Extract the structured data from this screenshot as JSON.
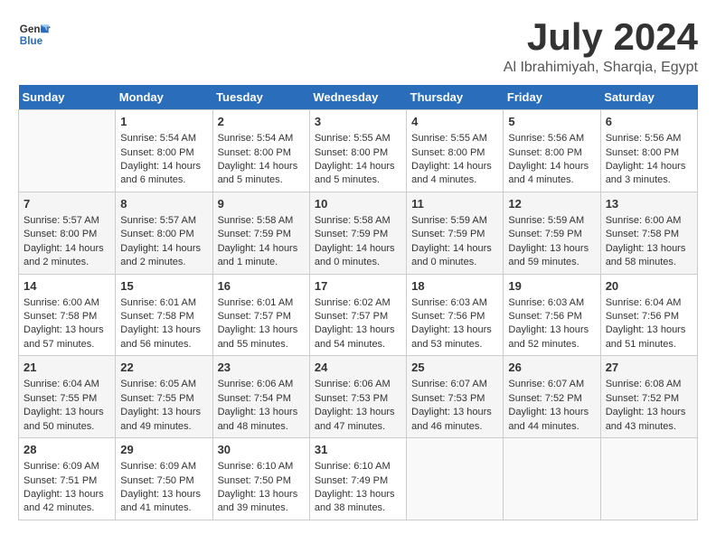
{
  "header": {
    "logo_line1": "General",
    "logo_line2": "Blue",
    "month_year": "July 2024",
    "location": "Al Ibrahimiyah, Sharqia, Egypt"
  },
  "days_of_week": [
    "Sunday",
    "Monday",
    "Tuesday",
    "Wednesday",
    "Thursday",
    "Friday",
    "Saturday"
  ],
  "weeks": [
    [
      {
        "day": "",
        "content": ""
      },
      {
        "day": "1",
        "content": "Sunrise: 5:54 AM\nSunset: 8:00 PM\nDaylight: 14 hours\nand 6 minutes."
      },
      {
        "day": "2",
        "content": "Sunrise: 5:54 AM\nSunset: 8:00 PM\nDaylight: 14 hours\nand 5 minutes."
      },
      {
        "day": "3",
        "content": "Sunrise: 5:55 AM\nSunset: 8:00 PM\nDaylight: 14 hours\nand 5 minutes."
      },
      {
        "day": "4",
        "content": "Sunrise: 5:55 AM\nSunset: 8:00 PM\nDaylight: 14 hours\nand 4 minutes."
      },
      {
        "day": "5",
        "content": "Sunrise: 5:56 AM\nSunset: 8:00 PM\nDaylight: 14 hours\nand 4 minutes."
      },
      {
        "day": "6",
        "content": "Sunrise: 5:56 AM\nSunset: 8:00 PM\nDaylight: 14 hours\nand 3 minutes."
      }
    ],
    [
      {
        "day": "7",
        "content": "Sunrise: 5:57 AM\nSunset: 8:00 PM\nDaylight: 14 hours\nand 2 minutes."
      },
      {
        "day": "8",
        "content": "Sunrise: 5:57 AM\nSunset: 8:00 PM\nDaylight: 14 hours\nand 2 minutes."
      },
      {
        "day": "9",
        "content": "Sunrise: 5:58 AM\nSunset: 7:59 PM\nDaylight: 14 hours\nand 1 minute."
      },
      {
        "day": "10",
        "content": "Sunrise: 5:58 AM\nSunset: 7:59 PM\nDaylight: 14 hours\nand 0 minutes."
      },
      {
        "day": "11",
        "content": "Sunrise: 5:59 AM\nSunset: 7:59 PM\nDaylight: 14 hours\nand 0 minutes."
      },
      {
        "day": "12",
        "content": "Sunrise: 5:59 AM\nSunset: 7:59 PM\nDaylight: 13 hours\nand 59 minutes."
      },
      {
        "day": "13",
        "content": "Sunrise: 6:00 AM\nSunset: 7:58 PM\nDaylight: 13 hours\nand 58 minutes."
      }
    ],
    [
      {
        "day": "14",
        "content": "Sunrise: 6:00 AM\nSunset: 7:58 PM\nDaylight: 13 hours\nand 57 minutes."
      },
      {
        "day": "15",
        "content": "Sunrise: 6:01 AM\nSunset: 7:58 PM\nDaylight: 13 hours\nand 56 minutes."
      },
      {
        "day": "16",
        "content": "Sunrise: 6:01 AM\nSunset: 7:57 PM\nDaylight: 13 hours\nand 55 minutes."
      },
      {
        "day": "17",
        "content": "Sunrise: 6:02 AM\nSunset: 7:57 PM\nDaylight: 13 hours\nand 54 minutes."
      },
      {
        "day": "18",
        "content": "Sunrise: 6:03 AM\nSunset: 7:56 PM\nDaylight: 13 hours\nand 53 minutes."
      },
      {
        "day": "19",
        "content": "Sunrise: 6:03 AM\nSunset: 7:56 PM\nDaylight: 13 hours\nand 52 minutes."
      },
      {
        "day": "20",
        "content": "Sunrise: 6:04 AM\nSunset: 7:56 PM\nDaylight: 13 hours\nand 51 minutes."
      }
    ],
    [
      {
        "day": "21",
        "content": "Sunrise: 6:04 AM\nSunset: 7:55 PM\nDaylight: 13 hours\nand 50 minutes."
      },
      {
        "day": "22",
        "content": "Sunrise: 6:05 AM\nSunset: 7:55 PM\nDaylight: 13 hours\nand 49 minutes."
      },
      {
        "day": "23",
        "content": "Sunrise: 6:06 AM\nSunset: 7:54 PM\nDaylight: 13 hours\nand 48 minutes."
      },
      {
        "day": "24",
        "content": "Sunrise: 6:06 AM\nSunset: 7:53 PM\nDaylight: 13 hours\nand 47 minutes."
      },
      {
        "day": "25",
        "content": "Sunrise: 6:07 AM\nSunset: 7:53 PM\nDaylight: 13 hours\nand 46 minutes."
      },
      {
        "day": "26",
        "content": "Sunrise: 6:07 AM\nSunset: 7:52 PM\nDaylight: 13 hours\nand 44 minutes."
      },
      {
        "day": "27",
        "content": "Sunrise: 6:08 AM\nSunset: 7:52 PM\nDaylight: 13 hours\nand 43 minutes."
      }
    ],
    [
      {
        "day": "28",
        "content": "Sunrise: 6:09 AM\nSunset: 7:51 PM\nDaylight: 13 hours\nand 42 minutes."
      },
      {
        "day": "29",
        "content": "Sunrise: 6:09 AM\nSunset: 7:50 PM\nDaylight: 13 hours\nand 41 minutes."
      },
      {
        "day": "30",
        "content": "Sunrise: 6:10 AM\nSunset: 7:50 PM\nDaylight: 13 hours\nand 39 minutes."
      },
      {
        "day": "31",
        "content": "Sunrise: 6:10 AM\nSunset: 7:49 PM\nDaylight: 13 hours\nand 38 minutes."
      },
      {
        "day": "",
        "content": ""
      },
      {
        "day": "",
        "content": ""
      },
      {
        "day": "",
        "content": ""
      }
    ]
  ]
}
